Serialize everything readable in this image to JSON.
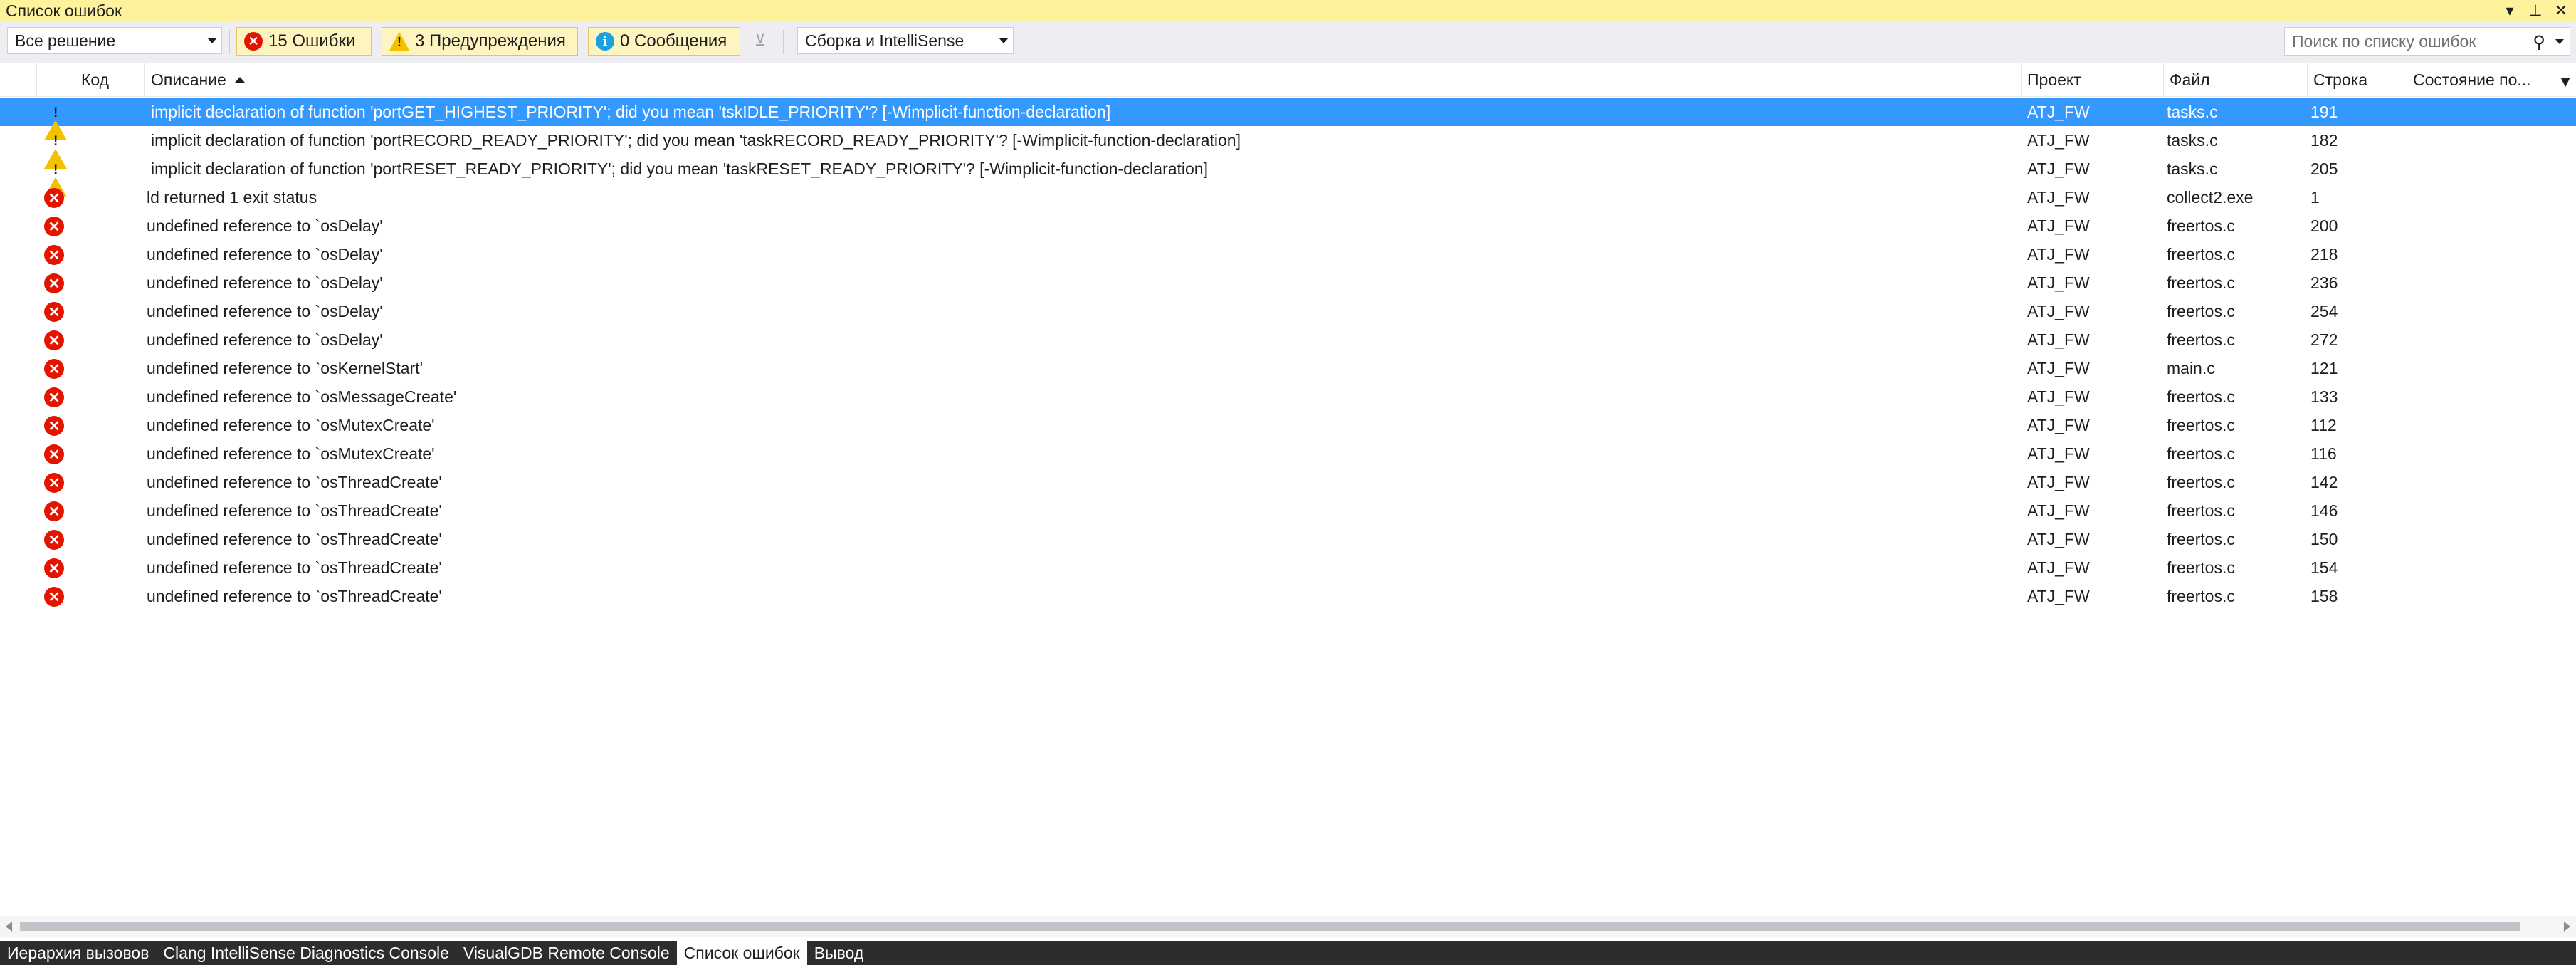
{
  "window": {
    "title": "Список ошибок"
  },
  "toolbar": {
    "scope_value": "Все решение",
    "errors_label": "15 Ошибки",
    "warnings_label": "3 Предупреждения",
    "messages_label": "0 Сообщения",
    "source_value": "Сборка и IntelliSense",
    "search_placeholder": "Поиск по списку ошибок"
  },
  "columns": {
    "code": "Код",
    "description": "Описание",
    "project": "Проект",
    "file": "Файл",
    "line": "Строка",
    "state": "Состояние по..."
  },
  "rows": [
    {
      "severity": "warning",
      "description": "implicit declaration of function 'portGET_HIGHEST_PRIORITY'; did you mean 'tskIDLE_PRIORITY'? [-Wimplicit-function-declaration]",
      "project": "ATJ_FW",
      "file": "tasks.c",
      "line": "191",
      "selected": true
    },
    {
      "severity": "warning",
      "description": "implicit declaration of function 'portRECORD_READY_PRIORITY'; did you mean 'taskRECORD_READY_PRIORITY'? [-Wimplicit-function-declaration]",
      "project": "ATJ_FW",
      "file": "tasks.c",
      "line": "182"
    },
    {
      "severity": "warning",
      "description": "implicit declaration of function 'portRESET_READY_PRIORITY'; did you mean 'taskRESET_READY_PRIORITY'? [-Wimplicit-function-declaration]",
      "project": "ATJ_FW",
      "file": "tasks.c",
      "line": "205"
    },
    {
      "severity": "error",
      "description": "ld returned 1 exit status",
      "project": "ATJ_FW",
      "file": "collect2.exe",
      "line": "1"
    },
    {
      "severity": "error",
      "description": "undefined reference to `osDelay'",
      "project": "ATJ_FW",
      "file": "freertos.c",
      "line": "200"
    },
    {
      "severity": "error",
      "description": "undefined reference to `osDelay'",
      "project": "ATJ_FW",
      "file": "freertos.c",
      "line": "218"
    },
    {
      "severity": "error",
      "description": "undefined reference to `osDelay'",
      "project": "ATJ_FW",
      "file": "freertos.c",
      "line": "236"
    },
    {
      "severity": "error",
      "description": "undefined reference to `osDelay'",
      "project": "ATJ_FW",
      "file": "freertos.c",
      "line": "254"
    },
    {
      "severity": "error",
      "description": "undefined reference to `osDelay'",
      "project": "ATJ_FW",
      "file": "freertos.c",
      "line": "272"
    },
    {
      "severity": "error",
      "description": "undefined reference to `osKernelStart'",
      "project": "ATJ_FW",
      "file": "main.c",
      "line": "121"
    },
    {
      "severity": "error",
      "description": "undefined reference to `osMessageCreate'",
      "project": "ATJ_FW",
      "file": "freertos.c",
      "line": "133"
    },
    {
      "severity": "error",
      "description": "undefined reference to `osMutexCreate'",
      "project": "ATJ_FW",
      "file": "freertos.c",
      "line": "112"
    },
    {
      "severity": "error",
      "description": "undefined reference to `osMutexCreate'",
      "project": "ATJ_FW",
      "file": "freertos.c",
      "line": "116"
    },
    {
      "severity": "error",
      "description": "undefined reference to `osThreadCreate'",
      "project": "ATJ_FW",
      "file": "freertos.c",
      "line": "142"
    },
    {
      "severity": "error",
      "description": "undefined reference to `osThreadCreate'",
      "project": "ATJ_FW",
      "file": "freertos.c",
      "line": "146"
    },
    {
      "severity": "error",
      "description": "undefined reference to `osThreadCreate'",
      "project": "ATJ_FW",
      "file": "freertos.c",
      "line": "150"
    },
    {
      "severity": "error",
      "description": "undefined reference to `osThreadCreate'",
      "project": "ATJ_FW",
      "file": "freertos.c",
      "line": "154"
    },
    {
      "severity": "error",
      "description": "undefined reference to `osThreadCreate'",
      "project": "ATJ_FW",
      "file": "freertos.c",
      "line": "158"
    }
  ],
  "tabs": [
    {
      "label": "Иерархия вызовов",
      "active": false
    },
    {
      "label": "Clang IntelliSense Diagnostics Console",
      "active": false
    },
    {
      "label": "VisualGDB Remote Console",
      "active": false
    },
    {
      "label": "Список ошибок",
      "active": true
    },
    {
      "label": "Вывод",
      "active": false
    }
  ],
  "colors": {
    "title_bar": "#fff29d",
    "selection": "#3399ff",
    "error": "#e51400",
    "warning": "#f4c100",
    "info": "#1ba1e2",
    "tab_strip": "#2d2d30"
  },
  "icons": [
    "dropdown-arrow-icon",
    "pin-icon",
    "close-icon",
    "error-icon",
    "warning-icon",
    "info-icon",
    "clear-filter-icon",
    "search-icon",
    "sort-ascending-icon",
    "filter-icon"
  ]
}
